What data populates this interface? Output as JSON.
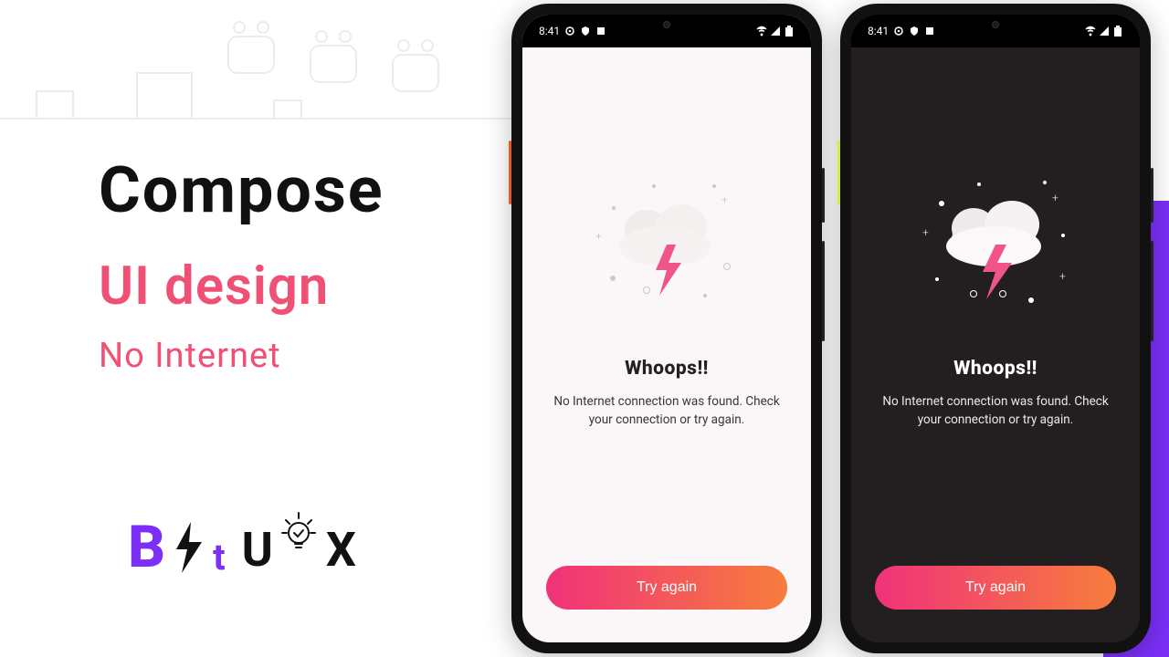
{
  "headline": {
    "line1": "Compose",
    "line2": "UI design",
    "line3": "No Internet"
  },
  "logo": {
    "b": "B",
    "t": "t",
    "u": "U",
    "x": "X"
  },
  "phone": {
    "status_time": "8:41",
    "screen": {
      "title": "Whoops!!",
      "message": "No Internet connection was found. Check your connection or try again.",
      "button_label": "Try again"
    }
  },
  "colors": {
    "accent_pink": "#f05074",
    "brand_purple": "#7b2ff7",
    "gradient_from": "#f0327a",
    "gradient_to": "#f77d3c"
  }
}
